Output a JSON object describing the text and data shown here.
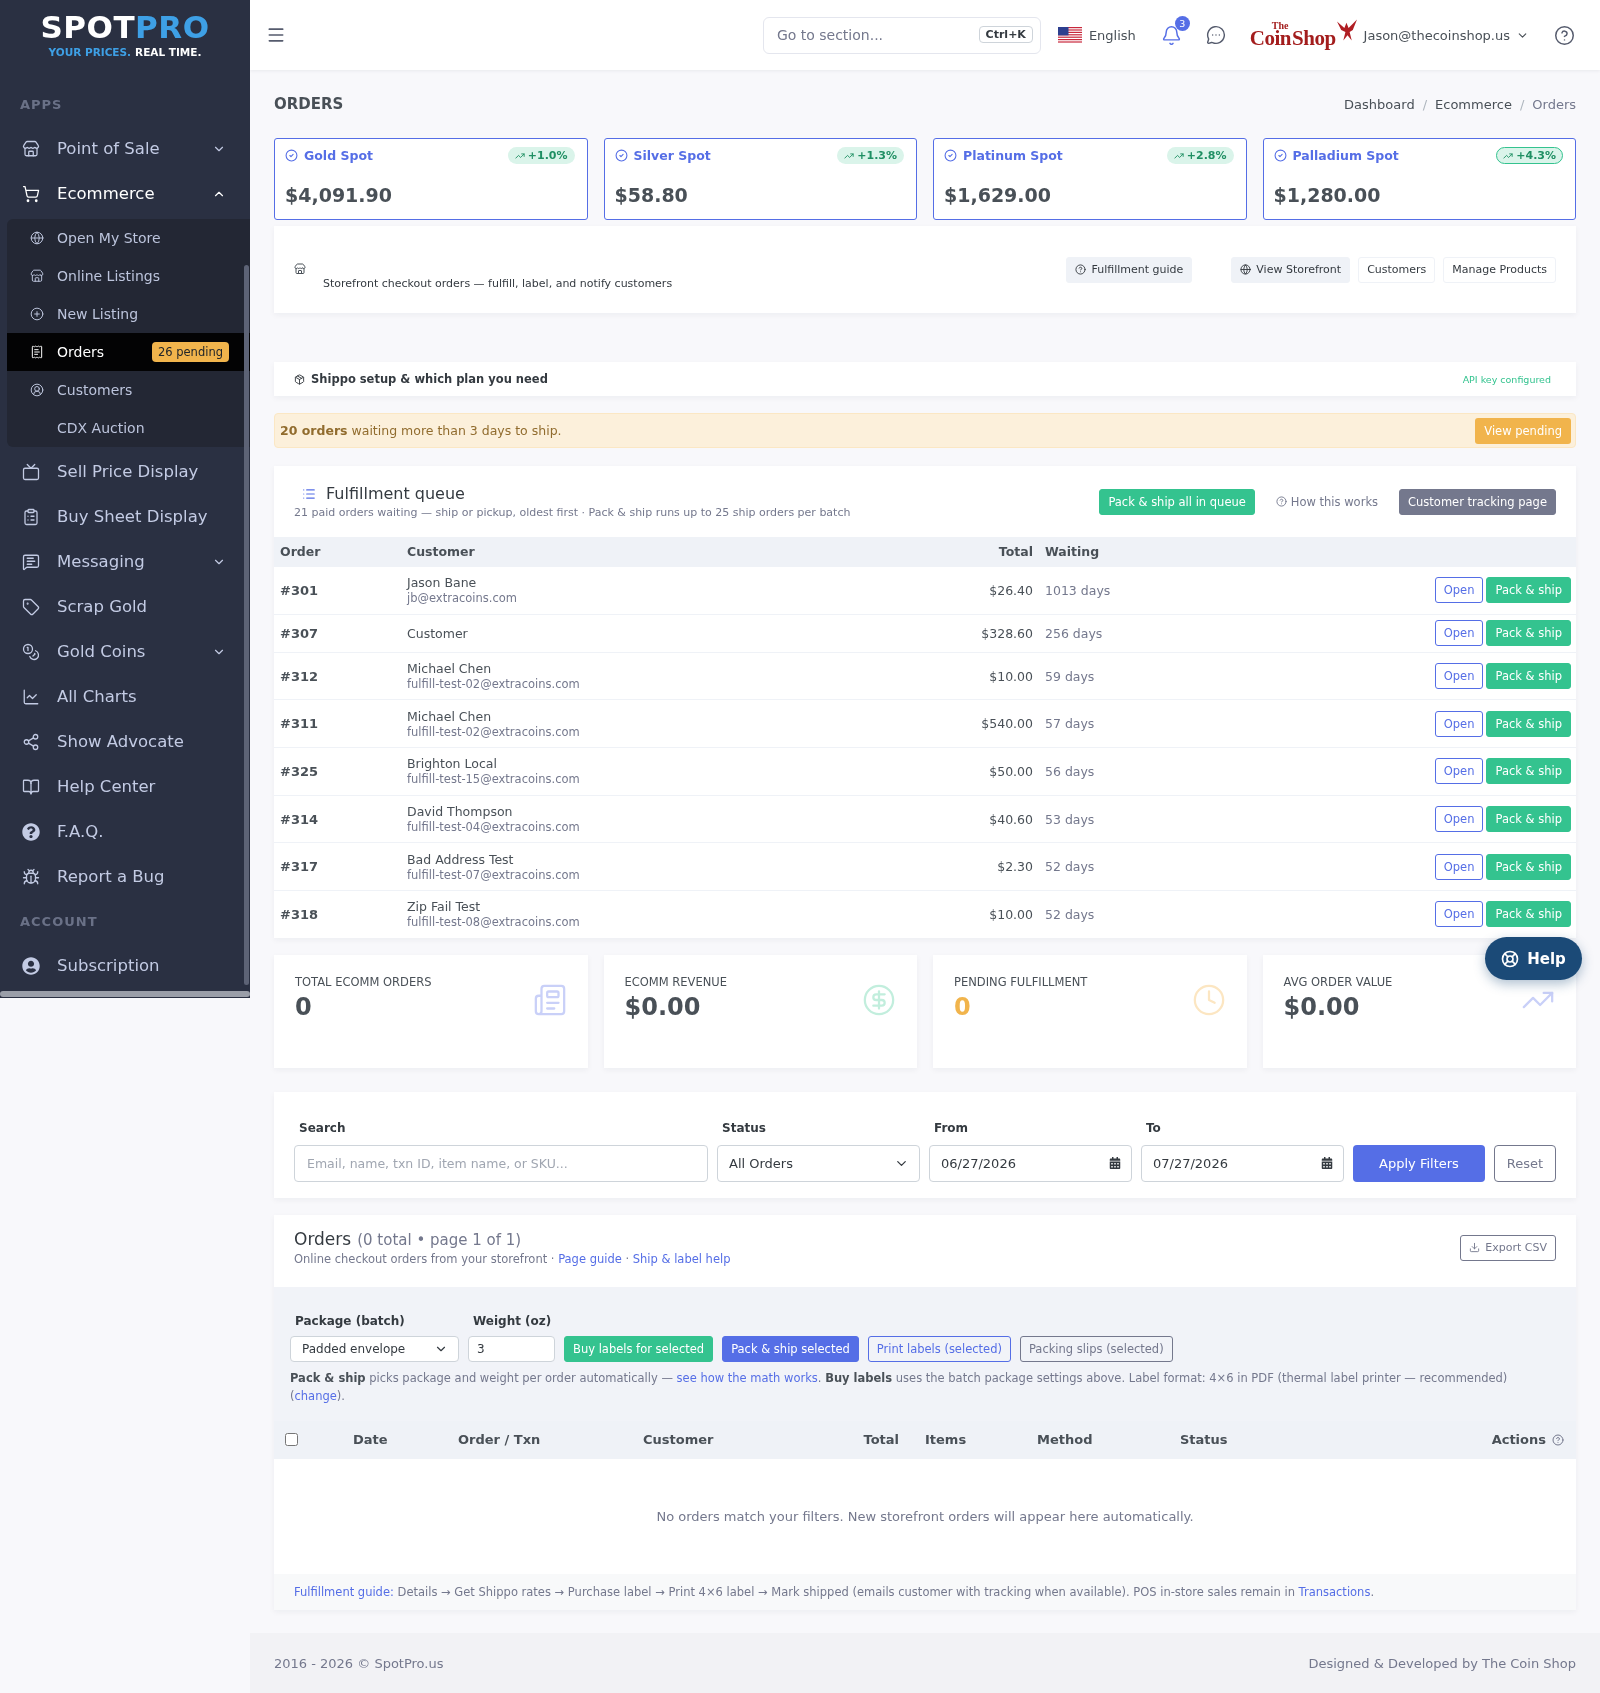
{
  "sidebar": {
    "logo": {
      "wordmark": "SPOT",
      "wordmark_accent": "PRO",
      "tagline_accent": "YOUR PRICES.",
      "tagline": "REAL TIME."
    },
    "sections": [
      {
        "title": "APPS",
        "items": [
          {
            "label": "Point of Sale",
            "selected": false,
            "expanded": false
          },
          {
            "label": "Ecommerce",
            "selected": false,
            "expanded": true,
            "children": [
              {
                "label": "Open My Store",
                "selected": false
              },
              {
                "label": "Online Listings",
                "selected": false
              },
              {
                "label": "New Listing",
                "selected": false
              },
              {
                "label": "Orders",
                "selected": true,
                "badge": "26 pending"
              },
              {
                "label": "Customers",
                "selected": false
              },
              {
                "label": "CDX Auction",
                "selected": false
              }
            ]
          },
          {
            "label": "Sell Price Display",
            "selected": false
          },
          {
            "label": "Buy Sheet Display",
            "selected": false
          },
          {
            "label": "Messaging",
            "selected": false,
            "expanded": false
          },
          {
            "label": "Scrap Gold",
            "selected": false
          },
          {
            "label": "Gold Coins",
            "selected": false,
            "expanded": false
          },
          {
            "label": "All Charts",
            "selected": false
          },
          {
            "label": "Show Advocate",
            "selected": false
          },
          {
            "label": "Help Center",
            "selected": false
          },
          {
            "label": "F.A.Q.",
            "selected": false
          },
          {
            "label": "Report a Bug",
            "selected": false
          }
        ]
      },
      {
        "title": "ACCOUNT",
        "items": [
          {
            "label": "Subscription",
            "selected": false
          }
        ]
      }
    ]
  },
  "header": {
    "search": {
      "placeholder": "Go to section...",
      "shortcut": "Ctrl+K"
    },
    "language": "English",
    "notifications": {
      "count": "3"
    },
    "company_logo": {
      "prefix": "The",
      "words": [
        "Coin",
        "Shop"
      ]
    },
    "user": "Jason@thecoinshop.us"
  },
  "page_title": "ORDERS",
  "breadcrumb": [
    {
      "label": "Dashboard",
      "current": false
    },
    {
      "separator": "/",
      "label": "Ecommerce",
      "current": false
    },
    {
      "separator": "/",
      "label": "Orders",
      "current": true
    }
  ],
  "spot_prices": [
    {
      "name": "Gold Spot",
      "change": "+1.0%",
      "outlined": false,
      "price": "$4,091.90"
    },
    {
      "name": "Silver Spot",
      "change": "+1.3%",
      "outlined": false,
      "price": "$58.80"
    },
    {
      "name": "Platinum Spot",
      "change": "+2.8%",
      "outlined": false,
      "price": "$1,629.00"
    },
    {
      "name": "Palladium Spot",
      "change": "+4.3%",
      "outlined": true,
      "price": "$1,280.00"
    }
  ],
  "storefront": {
    "description": "Storefront checkout orders — fulfill, label, and notify customers",
    "actions": [
      {
        "label": "Fulfillment guide",
        "kind": "guide"
      },
      {
        "label": "View Storefront",
        "kind": "storefront"
      },
      {
        "label": "Customers",
        "kind": "plain"
      },
      {
        "label": "Manage Products",
        "kind": "plain"
      }
    ]
  },
  "shippo": {
    "title": "Shippo setup & which plan you need",
    "status": "API key configured"
  },
  "alert": {
    "text": "**20 orders** waiting more than 3 days to ship.",
    "action": "View pending"
  },
  "queue": {
    "title": "Fulfillment queue",
    "subtitle": "21 paid orders waiting — ship or pickup, oldest first · Pack & ship runs up to 25 ship orders per batch",
    "actions": [
      {
        "label": "Pack & ship all in queue",
        "kind": "success"
      },
      {
        "label": "How this works",
        "kind": "help"
      },
      {
        "label": "Customer tracking page",
        "kind": "secondary"
      }
    ],
    "columns": [
      "Order",
      "Customer",
      "Total",
      "Waiting"
    ],
    "rows": [
      {
        "order": "#301",
        "name": "Jason Bane",
        "email": "jb@extracoins.com",
        "total": "$26.40",
        "waiting": "1013 days",
        "actions": [
          "Open",
          "Pack & ship"
        ]
      },
      {
        "order": "#307",
        "name": "Customer",
        "total": "$328.60",
        "waiting": "256 days",
        "actions": [
          "Open",
          "Pack & ship"
        ]
      },
      {
        "order": "#312",
        "name": "Michael Chen",
        "email": "fulfill-test-02@extracoins.com",
        "total": "$10.00",
        "waiting": "59 days",
        "actions": [
          "Open",
          "Pack & ship"
        ]
      },
      {
        "order": "#311",
        "name": "Michael Chen",
        "email": "fulfill-test-02@extracoins.com",
        "total": "$540.00",
        "waiting": "57 days",
        "actions": [
          "Open",
          "Pack & ship"
        ]
      },
      {
        "order": "#325",
        "name": "Brighton Local",
        "email": "fulfill-test-15@extracoins.com",
        "total": "$50.00",
        "waiting": "56 days",
        "actions": [
          "Open",
          "Pack & ship"
        ]
      },
      {
        "order": "#314",
        "name": "David Thompson",
        "email": "fulfill-test-04@extracoins.com",
        "total": "$40.60",
        "waiting": "53 days",
        "actions": [
          "Open",
          "Pack & ship"
        ]
      },
      {
        "order": "#317",
        "name": "Bad Address Test",
        "email": "fulfill-test-07@extracoins.com",
        "total": "$2.30",
        "waiting": "52 days",
        "actions": [
          "Open",
          "Pack & ship"
        ]
      },
      {
        "order": "#318",
        "name": "Zip Fail Test",
        "email": "fulfill-test-08@extracoins.com",
        "total": "$10.00",
        "waiting": "52 days",
        "actions": [
          "Open",
          "Pack & ship"
        ]
      }
    ]
  },
  "stats": [
    {
      "kind": "orders",
      "label": "TOTAL ECOMM ORDERS",
      "value": "0"
    },
    {
      "kind": "revenue",
      "label": "ECOMM REVENUE",
      "value": "$0.00"
    },
    {
      "kind": "pending",
      "label": "PENDING FULFILLMENT",
      "value": "0"
    },
    {
      "kind": "average",
      "label": "AVG ORDER VALUE",
      "value": "$0.00"
    }
  ],
  "help_button": "Help",
  "filters": {
    "search": {
      "label": "Search",
      "placeholder": "Email, name, txn ID, item name, or SKU..."
    },
    "status": {
      "label": "Status",
      "value": "All Orders"
    },
    "from": {
      "label": "From",
      "value": "06/27/2026"
    },
    "to": {
      "label": "To",
      "value": "07/27/2026"
    },
    "apply": "Apply Filters",
    "reset": "Reset"
  },
  "orders": {
    "title": "Orders",
    "summary": "(0 total • page 1 of 1)",
    "subtitle": [
      {
        "kind": "text",
        "text": "Online checkout orders from your storefront · "
      },
      {
        "kind": "link",
        "text": "Page guide"
      },
      {
        "kind": "text",
        "text": " · "
      },
      {
        "kind": "link",
        "text": "Ship & label help"
      }
    ],
    "export": "Export CSV",
    "batch": {
      "package": {
        "label": "Package (batch)",
        "value": "Padded envelope"
      },
      "weight": {
        "label": "Weight (oz)",
        "value": "3"
      },
      "actions": [
        {
          "label": "Buy labels for selected",
          "kind": "success"
        },
        {
          "label": "Pack & ship selected",
          "kind": "primary"
        },
        {
          "label": "Print labels (selected)",
          "kind": "outline-primary"
        },
        {
          "label": "Packing slips (selected)",
          "kind": "outline-secondary"
        }
      ]
    },
    "note": [
      {
        "kind": "text",
        "text": "**Pack & ship** picks package and weight per order automatically — "
      },
      {
        "kind": "link",
        "text": "see how the math works"
      },
      {
        "kind": "text",
        "text": ". **Buy labels** uses the batch package settings above. Label format: 4×6 in PDF (thermal label printer — recommended) ("
      },
      {
        "kind": "link",
        "text": "change"
      },
      {
        "kind": "text",
        "text": ")."
      }
    ],
    "select_all": {
      "checked": false
    },
    "columns": [
      "Date",
      "Order / Txn",
      "Customer",
      "Total",
      "Items",
      "Method",
      "Status",
      "Actions"
    ],
    "empty": "No orders match your filters. New storefront orders will appear here automatically.",
    "guide": [
      {
        "kind": "link",
        "text": "Fulfillment guide:"
      },
      {
        "kind": "text",
        "text": " Details → Get Shippo rates → Purchase label → Print 4×6 label → Mark shipped (emails customer with tracking when available). POS in-store sales remain in "
      },
      {
        "kind": "link",
        "text": "Transactions"
      },
      {
        "kind": "text",
        "text": "."
      }
    ]
  },
  "footer": {
    "copyright": "2016 - 2026 © SpotPro.us",
    "credit": "Designed & Developed by The Coin Shop"
  }
}
